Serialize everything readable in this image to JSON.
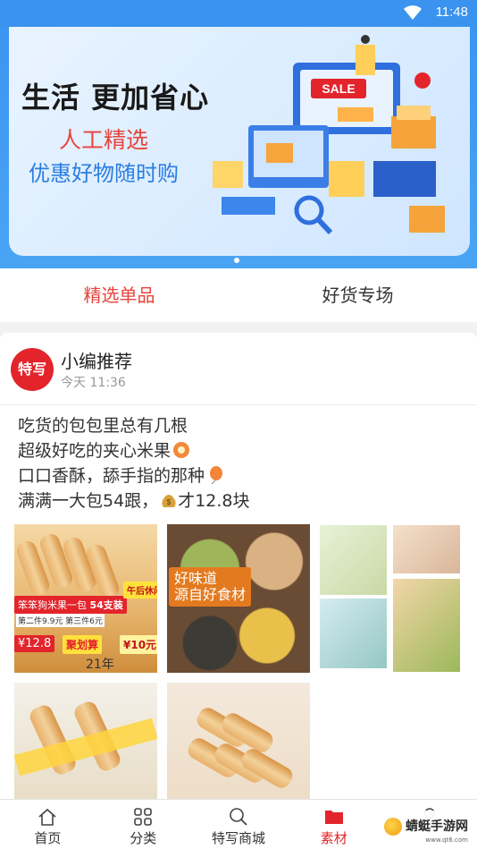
{
  "status_bar": {
    "time": "11:48"
  },
  "banner": {
    "title": "生活 更加省心",
    "subtitle1": "人工精选",
    "subtitle2": "优惠好物随时购",
    "art_sign": "SALE"
  },
  "tabs": [
    {
      "label": "精选单品",
      "active": true
    },
    {
      "label": "好货专场",
      "active": false
    }
  ],
  "post": {
    "avatar_text": "特写",
    "author": "小编推荐",
    "time": "今天 11:36",
    "lines": [
      "吃货的包包里总有几根",
      "超级好吃的夹心米果",
      "口口香酥，舔手指的那种",
      "满满一大包54跟，",
      "才12.8块"
    ],
    "photo1": {
      "banner_text": "笨笨狗米果一包",
      "count": "54支装",
      "promo": "第二件9.9元 第三件6元",
      "badge": "午后休闲零食",
      "price": "¥12.8",
      "deal": "聚划算",
      "coupon": "¥10元",
      "year": "21年"
    },
    "photo2": {
      "label_line1": "好味道",
      "label_line2": "源自好食材"
    }
  },
  "bottom_nav": [
    {
      "label": "首页",
      "icon": "home-icon",
      "active": false
    },
    {
      "label": "分类",
      "icon": "category-grid-icon",
      "active": false
    },
    {
      "label": "特写商城",
      "icon": "search-icon",
      "active": false
    },
    {
      "label": "素材",
      "icon": "folder-icon",
      "active": true
    },
    {
      "label": "",
      "icon": "user-icon",
      "active": false
    }
  ],
  "watermark": {
    "text": "蜻蜓手游网",
    "sub": "www.qt6.com"
  },
  "colors": {
    "accent": "#e3242b",
    "header_blue": "#3a93ef"
  }
}
